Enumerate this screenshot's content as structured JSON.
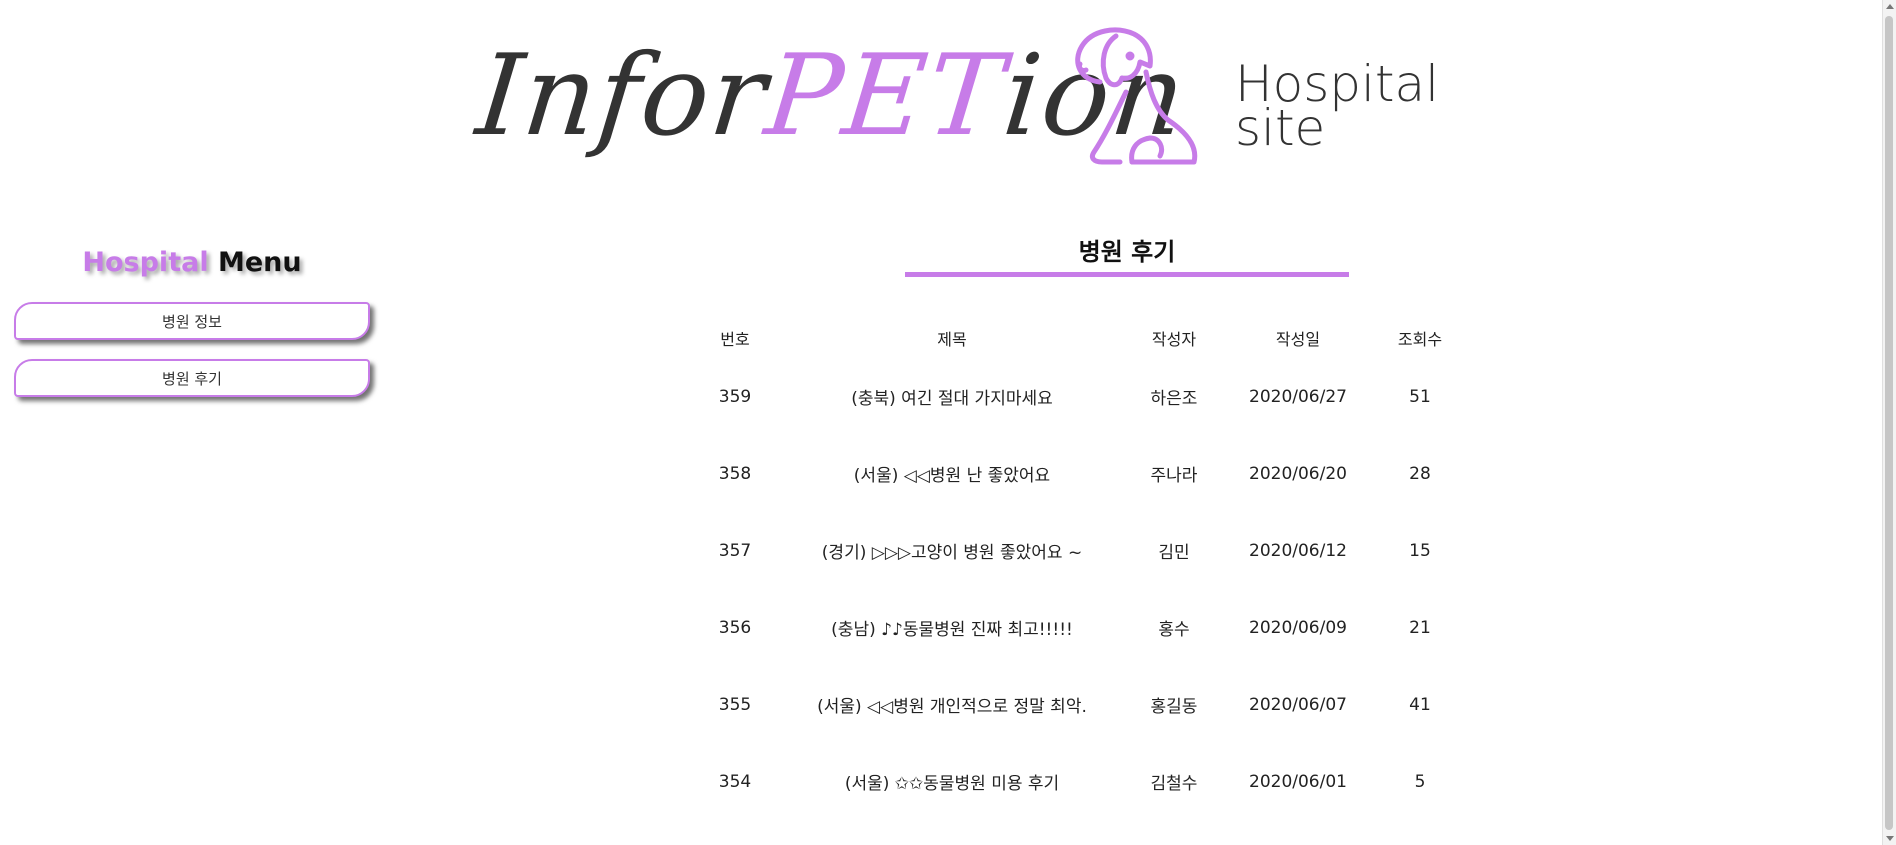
{
  "logo": {
    "word_part1": "Infor",
    "word_part2": "PET",
    "word_part3": "ion",
    "sub_line1": "Hospital",
    "sub_line2": "site",
    "accent_color": "#c77ce8",
    "icon": "dog-icon"
  },
  "sidebar": {
    "title_accent": "Hospital",
    "title_main": "Menu",
    "items": [
      {
        "label": "병원 정보"
      },
      {
        "label": "병원 후기"
      }
    ]
  },
  "board": {
    "title": "병원 후기",
    "columns": [
      "번호",
      "제목",
      "작성자",
      "작성일",
      "조회수"
    ],
    "rows": [
      {
        "no": "359",
        "subject": "(충북) 여긴 절대 가지마세요",
        "author": "하은조",
        "date": "2020/06/27",
        "views": "51"
      },
      {
        "no": "358",
        "subject": "(서울) ◁◁병원 난 좋았어요",
        "author": "주나라",
        "date": "2020/06/20",
        "views": "28"
      },
      {
        "no": "357",
        "subject": "(경기) ▷▷▷고양이 병원 좋았어요 ~",
        "author": "김민",
        "date": "2020/06/12",
        "views": "15"
      },
      {
        "no": "356",
        "subject": "(충남) ♪♪동물병원 진짜 최고!!!!!",
        "author": "홍수",
        "date": "2020/06/09",
        "views": "21"
      },
      {
        "no": "355",
        "subject": "(서울) ◁◁병원 개인적으로 정말 최악.",
        "author": "홍길동",
        "date": "2020/06/07",
        "views": "41"
      },
      {
        "no": "354",
        "subject": "(서울) ✩✩동물병원 미용 후기",
        "author": "김철수",
        "date": "2020/06/01",
        "views": "5"
      }
    ]
  }
}
